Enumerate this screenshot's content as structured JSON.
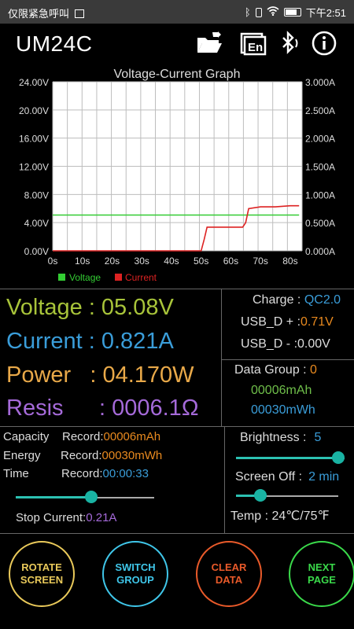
{
  "status_bar": {
    "left_text": "仅限紧急呼叫",
    "time": "下午2:51"
  },
  "header": {
    "title": "UM24C"
  },
  "graph": {
    "chart_data": {
      "type": "line",
      "title": "Voltage-Current Graph",
      "x": [
        0,
        5,
        10,
        15,
        20,
        25,
        30,
        35,
        40,
        45,
        50,
        51,
        52,
        55,
        60,
        64,
        65,
        66,
        70,
        75,
        80,
        83
      ],
      "x_ticks": [
        "0s",
        "10s",
        "20s",
        "30s",
        "40s",
        "50s",
        "60s",
        "70s",
        "80s"
      ],
      "y_left_ticks": [
        "0.00V",
        "4.00V",
        "8.00V",
        "12.00V",
        "16.00V",
        "20.00V",
        "24.00V"
      ],
      "y_right_ticks": [
        "0.000A",
        "0.500A",
        "1.000A",
        "1.500A",
        "2.000A",
        "2.500A",
        "3.000A"
      ],
      "ylim_left": [
        0,
        24
      ],
      "ylim_right": [
        0,
        3
      ],
      "xlim": [
        0,
        84
      ],
      "series": [
        {
          "name": "Voltage",
          "axis": "left",
          "color": "#33cc33",
          "values": [
            5.08,
            5.08,
            5.08,
            5.08,
            5.08,
            5.08,
            5.08,
            5.08,
            5.08,
            5.08,
            5.08,
            5.08,
            5.08,
            5.08,
            5.08,
            5.08,
            5.08,
            5.08,
            5.08,
            5.08,
            5.08,
            5.08
          ]
        },
        {
          "name": "Current",
          "axis": "right",
          "color": "#dd2222",
          "values": [
            0,
            0,
            0,
            0,
            0,
            0,
            0,
            0,
            0,
            0,
            0,
            0.2,
            0.42,
            0.42,
            0.42,
            0.42,
            0.5,
            0.75,
            0.78,
            0.78,
            0.8,
            0.8
          ]
        }
      ],
      "legend": [
        "Voltage",
        "Current"
      ],
      "grid": true
    }
  },
  "main": {
    "voltage": "Voltage : 05.08V",
    "current": "Current : 0.821A",
    "power": "Power   : 04.170W",
    "resis_label": "Resis",
    "resis_value": ": 0006.1Ω"
  },
  "side": {
    "charge_label": "Charge : ",
    "charge_value": "QC2.0",
    "usb_dp_label": "USB_D + :",
    "usb_dp_value": "0.71V",
    "usb_dm_label": "USB_D - :",
    "usb_dm_value": "0.00V",
    "data_group_label": "Data Group : ",
    "data_group_value": "0",
    "group_mah": "00006mAh",
    "group_mwh": "00030mWh"
  },
  "records": {
    "capacity_label": "Capacity",
    "capacity_record_label": "Record:",
    "capacity_value": "00006mAh",
    "energy_label": "Energy",
    "energy_record_label": "Record:",
    "energy_value": "00030mWh",
    "time_label": "Time",
    "time_record_label": "Record:",
    "time_value": "00:00:33",
    "stop_current_label": "Stop Current:",
    "stop_current_value": "0.21A",
    "stop_current_slider": 0.55
  },
  "settings": {
    "brightness_label": "Brightness :",
    "brightness_value": "5",
    "brightness_slider": 1.0,
    "screen_off_label": "Screen Off :",
    "screen_off_value": "2 min",
    "screen_off_slider": 0.2,
    "temp": "Temp : 24℃/75℉"
  },
  "buttons": {
    "rotate": [
      "ROTATE",
      "SCREEN"
    ],
    "switch": [
      "SWITCH",
      "GROUP"
    ],
    "clear": [
      "CLEAR",
      "DATA"
    ],
    "next": [
      "NEXT",
      "PAGE"
    ]
  },
  "colors": {
    "voltage": "#a8c43a",
    "current": "#3a9dd9",
    "power": "#e9a949",
    "resis": "#a56ad9",
    "orange": "#e98a1f",
    "green": "#6fbf4a",
    "blue": "#3a9dd9",
    "teal": "#2cc1b2"
  }
}
